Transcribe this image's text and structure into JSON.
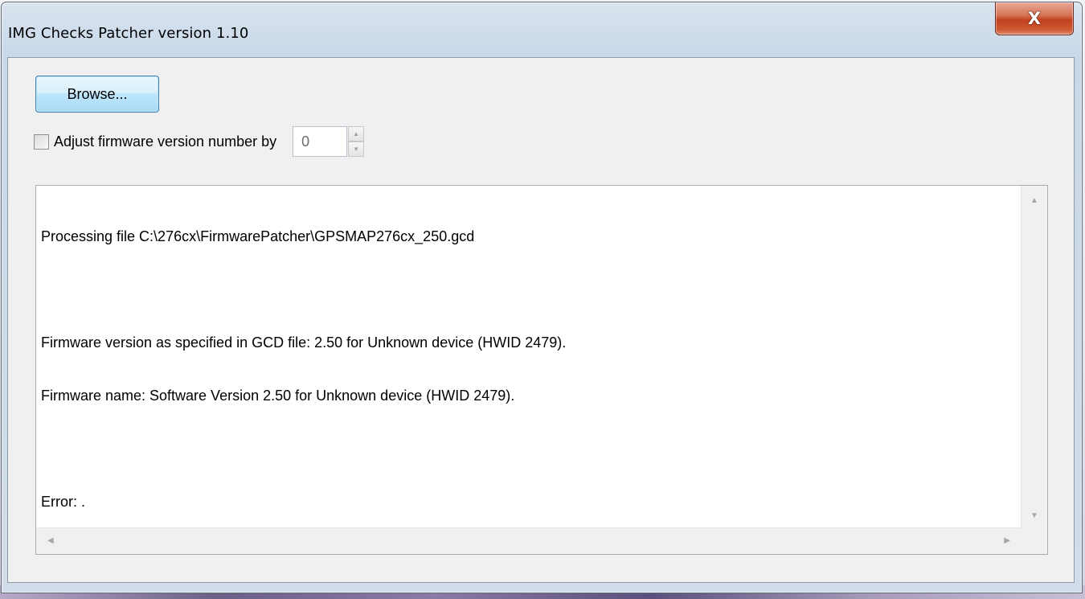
{
  "window": {
    "title": "IMG Checks Patcher version 1.10",
    "close_glyph": "X"
  },
  "toolbar": {
    "browse_label": "Browse..."
  },
  "adjust": {
    "label": "Adjust firmware version number by",
    "checked": false,
    "value": "0"
  },
  "log": {
    "lines": [
      "Processing file C:\\276cx\\FirmwarePatcher\\GPSMAP276cx_250.gcd",
      "",
      "Firmware version as specified in GCD file: 2.50 for Unknown device (HWID 2479).",
      "Firmware name: Software Version 2.50 for Unknown device (HWID 2479).",
      "",
      "Error: ."
    ]
  },
  "icons": {
    "close": "close-icon",
    "spin_up": "chevron-up-icon",
    "spin_down": "chevron-down-icon",
    "scroll_up": "scroll-up-arrow-icon",
    "scroll_down": "scroll-down-arrow-icon",
    "scroll_left": "scroll-left-arrow-icon",
    "scroll_right": "scroll-right-arrow-icon"
  },
  "colors": {
    "close_button": "#c9492a",
    "button_border": "#3c7fb1",
    "window_frame": "#cfdceb"
  }
}
